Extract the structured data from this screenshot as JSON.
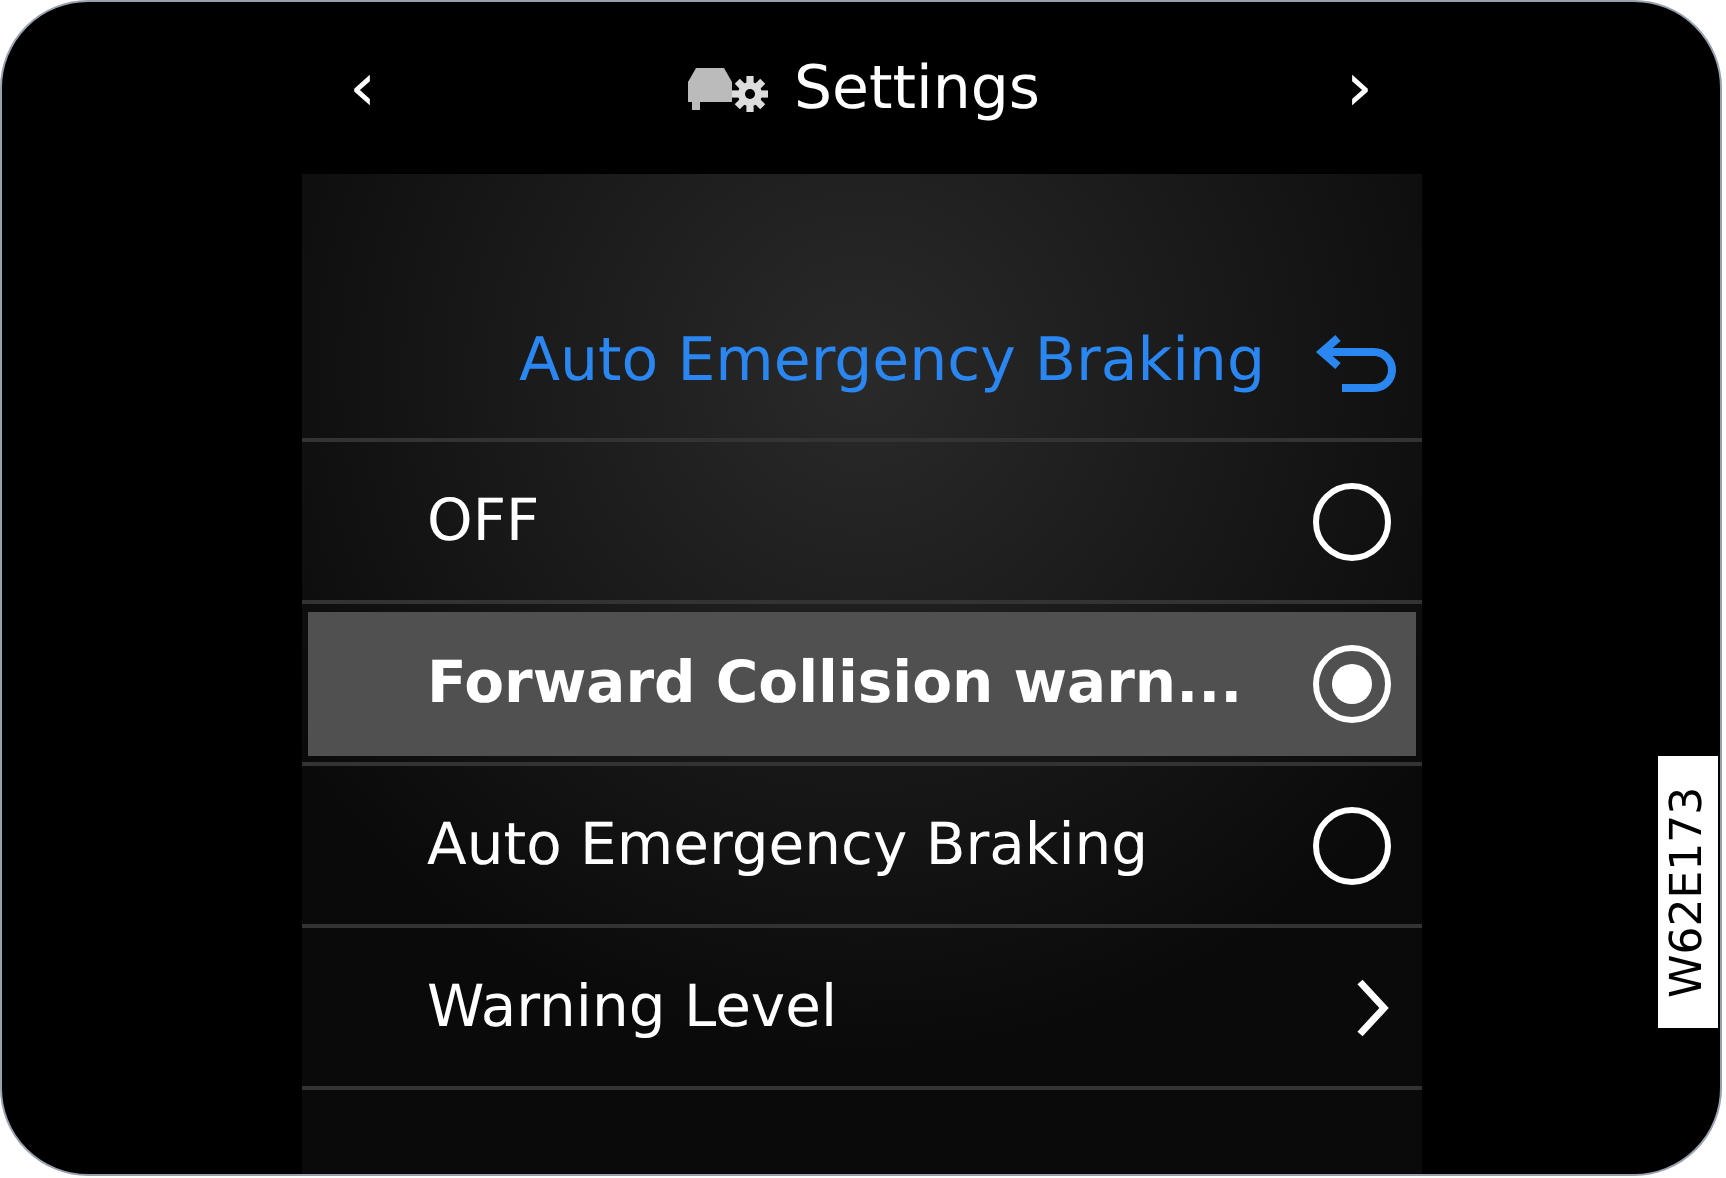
{
  "header": {
    "prev": "‹",
    "title": "Settings",
    "next": "›"
  },
  "subtitle": "Auto Emergency Braking",
  "options": [
    {
      "kind": "radio",
      "label": "OFF",
      "selected": false
    },
    {
      "kind": "radio",
      "label": "Forward Collision warn...",
      "selected": true
    },
    {
      "kind": "radio",
      "label": "Auto Emergency Braking",
      "selected": false
    },
    {
      "kind": "link",
      "label": "Warning Level"
    }
  ],
  "figure_code": "W62E173"
}
